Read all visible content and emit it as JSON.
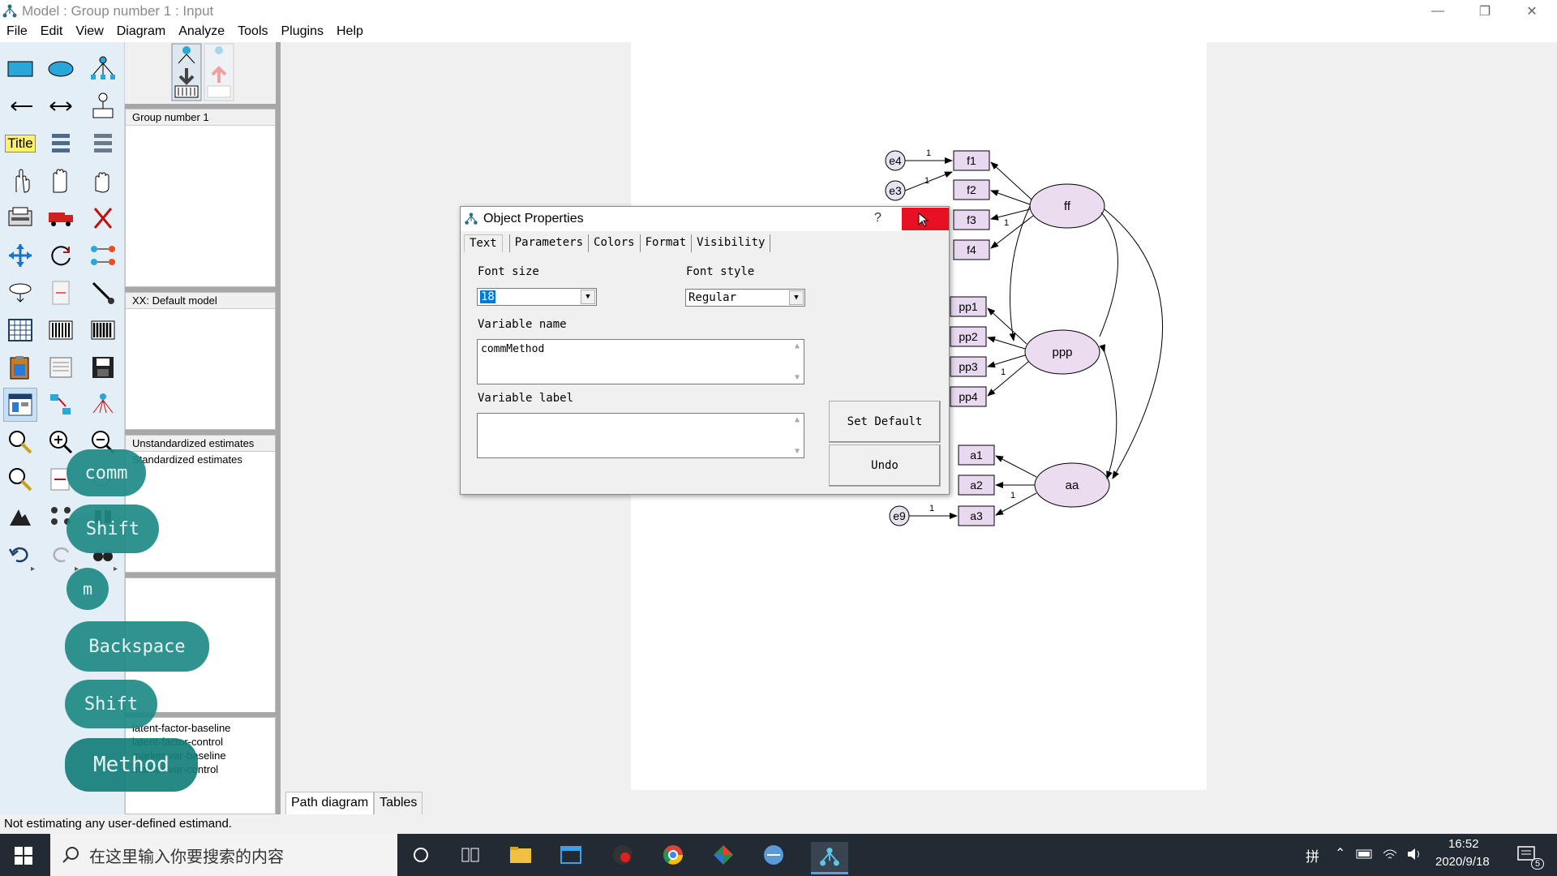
{
  "window": {
    "title": "Model : Group number 1 : Input"
  },
  "menu": [
    "File",
    "Edit",
    "View",
    "Diagram",
    "Analyze",
    "Tools",
    "Plugins",
    "Help"
  ],
  "panels": {
    "groups": {
      "items": [
        "Group number 1"
      ]
    },
    "models": {
      "items": [
        "XX: Default model"
      ]
    },
    "estimates": {
      "items": [
        "Unstandardized estimates",
        "Standardized estimates"
      ]
    },
    "files": {
      "items": [
        "latent-factor-baseline",
        "latent-factor-control",
        "marker-var-baseline",
        "marker-var-control"
      ]
    }
  },
  "toolbar": {
    "title_tool": "Title"
  },
  "bottom_tabs": [
    "Path diagram",
    "Tables"
  ],
  "status": "Not estimating any user-defined estimand.",
  "taskbar": {
    "search_placeholder": "在这里输入你要搜索的内容",
    "time": "16:52",
    "date": "2020/9/18",
    "ime": "拼",
    "notif_count": "5"
  },
  "dialog": {
    "title": "Object Properties",
    "help": "?",
    "tabs": [
      "Text",
      "Parameters",
      "Colors",
      "Format",
      "Visibility"
    ],
    "font_size_label": "Font size",
    "font_size_value": "18",
    "font_style_label": "Font style",
    "font_style_value": "Regular",
    "var_name_label": "Variable name",
    "var_name_value": "commMethod",
    "var_label_label": "Variable label",
    "var_label_value": "",
    "set_default": "Set Default",
    "undo": "Undo"
  },
  "keys": [
    "comm",
    "Shift",
    "m",
    "Backspace",
    "Shift",
    "Method"
  ],
  "diagram": {
    "errors": [
      "e4",
      "e3",
      "e9"
    ],
    "observed": [
      "f1",
      "f2",
      "f3",
      "f4",
      "pp1",
      "pp2",
      "pp3",
      "pp4",
      "a1",
      "a2",
      "a3"
    ],
    "latent": [
      "ff",
      "ppp",
      "aa"
    ],
    "path_labels": [
      "1",
      "1",
      "1",
      "1",
      "1",
      "1"
    ]
  },
  "colors": {
    "latent_fill": "#ecdcf0",
    "observed_fill": "#e8d8f0",
    "close_red": "#e81123",
    "key_teal": "#1e8a86"
  }
}
